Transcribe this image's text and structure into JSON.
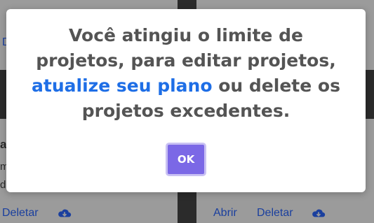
{
  "background": {
    "left_card": {
      "letter_a": "a",
      "frag_m": "m",
      "frag_d": "d",
      "top_link_fragment": "D",
      "delete_label": "Deletar",
      "download_icon": "cloud-download-icon"
    },
    "right_card": {
      "open_label": "Abrir",
      "delete_label": "Deletar",
      "download_icon": "cloud-download-icon"
    }
  },
  "modal": {
    "message_part1": "Você atingiu o limite de projetos, para editar projetos, ",
    "message_link": "atualize seu plano",
    "message_part2": " ou delete os projetos excedentes.",
    "ok_label": "OK"
  },
  "colors": {
    "link": "#1e6ee6",
    "button": "#7b68e6",
    "text": "#545454"
  }
}
